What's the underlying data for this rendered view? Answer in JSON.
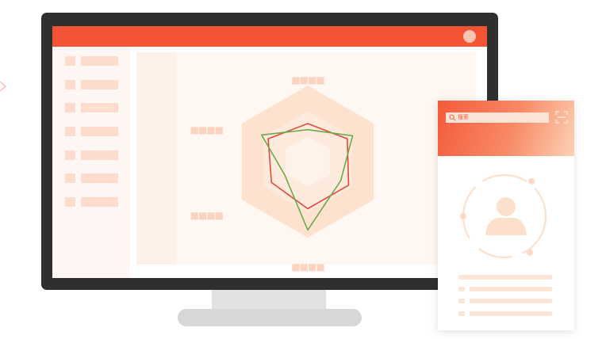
{
  "illustration": {
    "radar_labels": {
      "top": "■■■■",
      "upper_left": "■■■■",
      "lower_left": "■■■■",
      "bottom": "■■■■"
    },
    "phone": {
      "search_placeholder": "搜索"
    },
    "icons": [
      "chevron-right-icon",
      "search-icon",
      "scan-icon",
      "user-avatar-icon"
    ],
    "colors": {
      "accent": "#f45434",
      "monitor_frame": "#2f2f2f",
      "radar_hexagon": "#fde2cf",
      "series_red": "#e04a3c",
      "series_green": "#6aac4a"
    }
  },
  "chart_data": {
    "type": "radar",
    "axes_count": 6,
    "levels": 3,
    "series": [
      {
        "color": "#e04a3c",
        "values": [
          0.5,
          0.6,
          0.62,
          0.62,
          0.55,
          0.6
        ]
      },
      {
        "color": "#6aac4a",
        "values": [
          0.42,
          0.68,
          0.5,
          0.9,
          0.35,
          0.7
        ]
      }
    ]
  }
}
